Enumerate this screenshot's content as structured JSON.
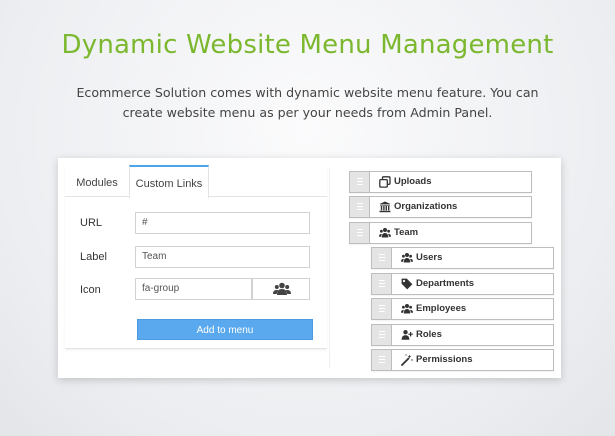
{
  "headline": "Dynamic Website Menu Management",
  "subtitle": "Ecommerce Solution comes with dynamic website menu feature. You can create website menu as per your needs from Admin Panel.",
  "colors": {
    "headline": "#7cb82f",
    "button": "#5aa9ee",
    "active_tab": "#4da3e8"
  },
  "tabs": [
    {
      "label": "Modules",
      "active": false
    },
    {
      "label": "Custom Links",
      "active": true
    }
  ],
  "form": {
    "url_label": "URL",
    "url_value": "#",
    "label_label": "Label",
    "label_value": "Team",
    "icon_label": "Icon",
    "icon_value": "fa-group",
    "icon_preview": "users-icon",
    "add_button": "Add to menu"
  },
  "menu": {
    "top_level": [
      {
        "label": "Uploads",
        "icon": "clone-icon"
      },
      {
        "label": "Organizations",
        "icon": "institution-icon"
      },
      {
        "label": "Team",
        "icon": "users-icon"
      }
    ],
    "team_children": [
      {
        "label": "Users",
        "icon": "users-icon"
      },
      {
        "label": "Departments",
        "icon": "tag-icon"
      },
      {
        "label": "Employees",
        "icon": "users-icon"
      },
      {
        "label": "Roles",
        "icon": "user-plus-icon"
      },
      {
        "label": "Permissions",
        "icon": "magic-wand-icon"
      }
    ]
  }
}
